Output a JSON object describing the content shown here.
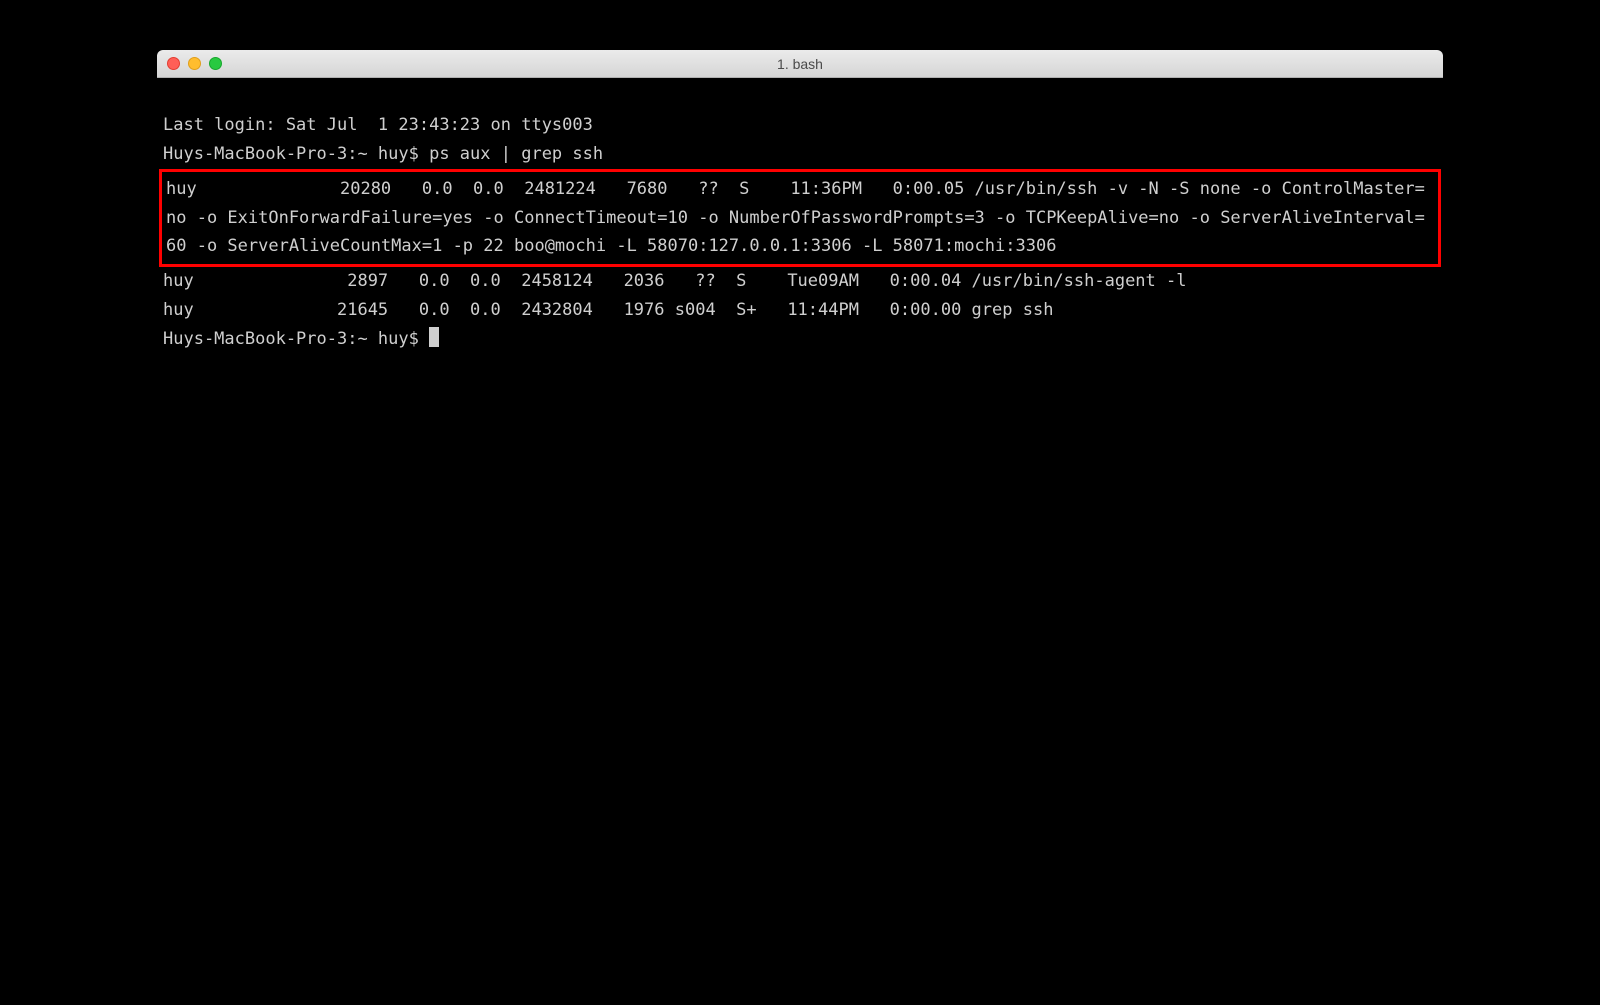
{
  "window": {
    "title": "1. bash"
  },
  "terminal": {
    "login_line": "Last login: Sat Jul  1 23:43:23 on ttys003",
    "prompt1": "Huys-MacBook-Pro-3:~ huy$ ps aux | grep ssh",
    "highlighted": "huy              20280   0.0  0.0  2481224   7680   ??  S    11:36PM   0:00.05 /usr/bin/ssh -v -N -S none -o ControlMaster=no -o ExitOnForwardFailure=yes -o ConnectTimeout=10 -o NumberOfPasswordPrompts=3 -o TCPKeepAlive=no -o ServerAliveInterval=60 -o ServerAliveCountMax=1 -p 22 boo@mochi -L 58070:127.0.0.1:3306 -L 58071:mochi:3306",
    "row2": "huy               2897   0.0  0.0  2458124   2036   ??  S    Tue09AM   0:00.04 /usr/bin/ssh-agent -l",
    "row3": "huy              21645   0.0  0.0  2432804   1976 s004  S+   11:44PM   0:00.00 grep ssh",
    "prompt2": "Huys-MacBook-Pro-3:~ huy$ "
  }
}
